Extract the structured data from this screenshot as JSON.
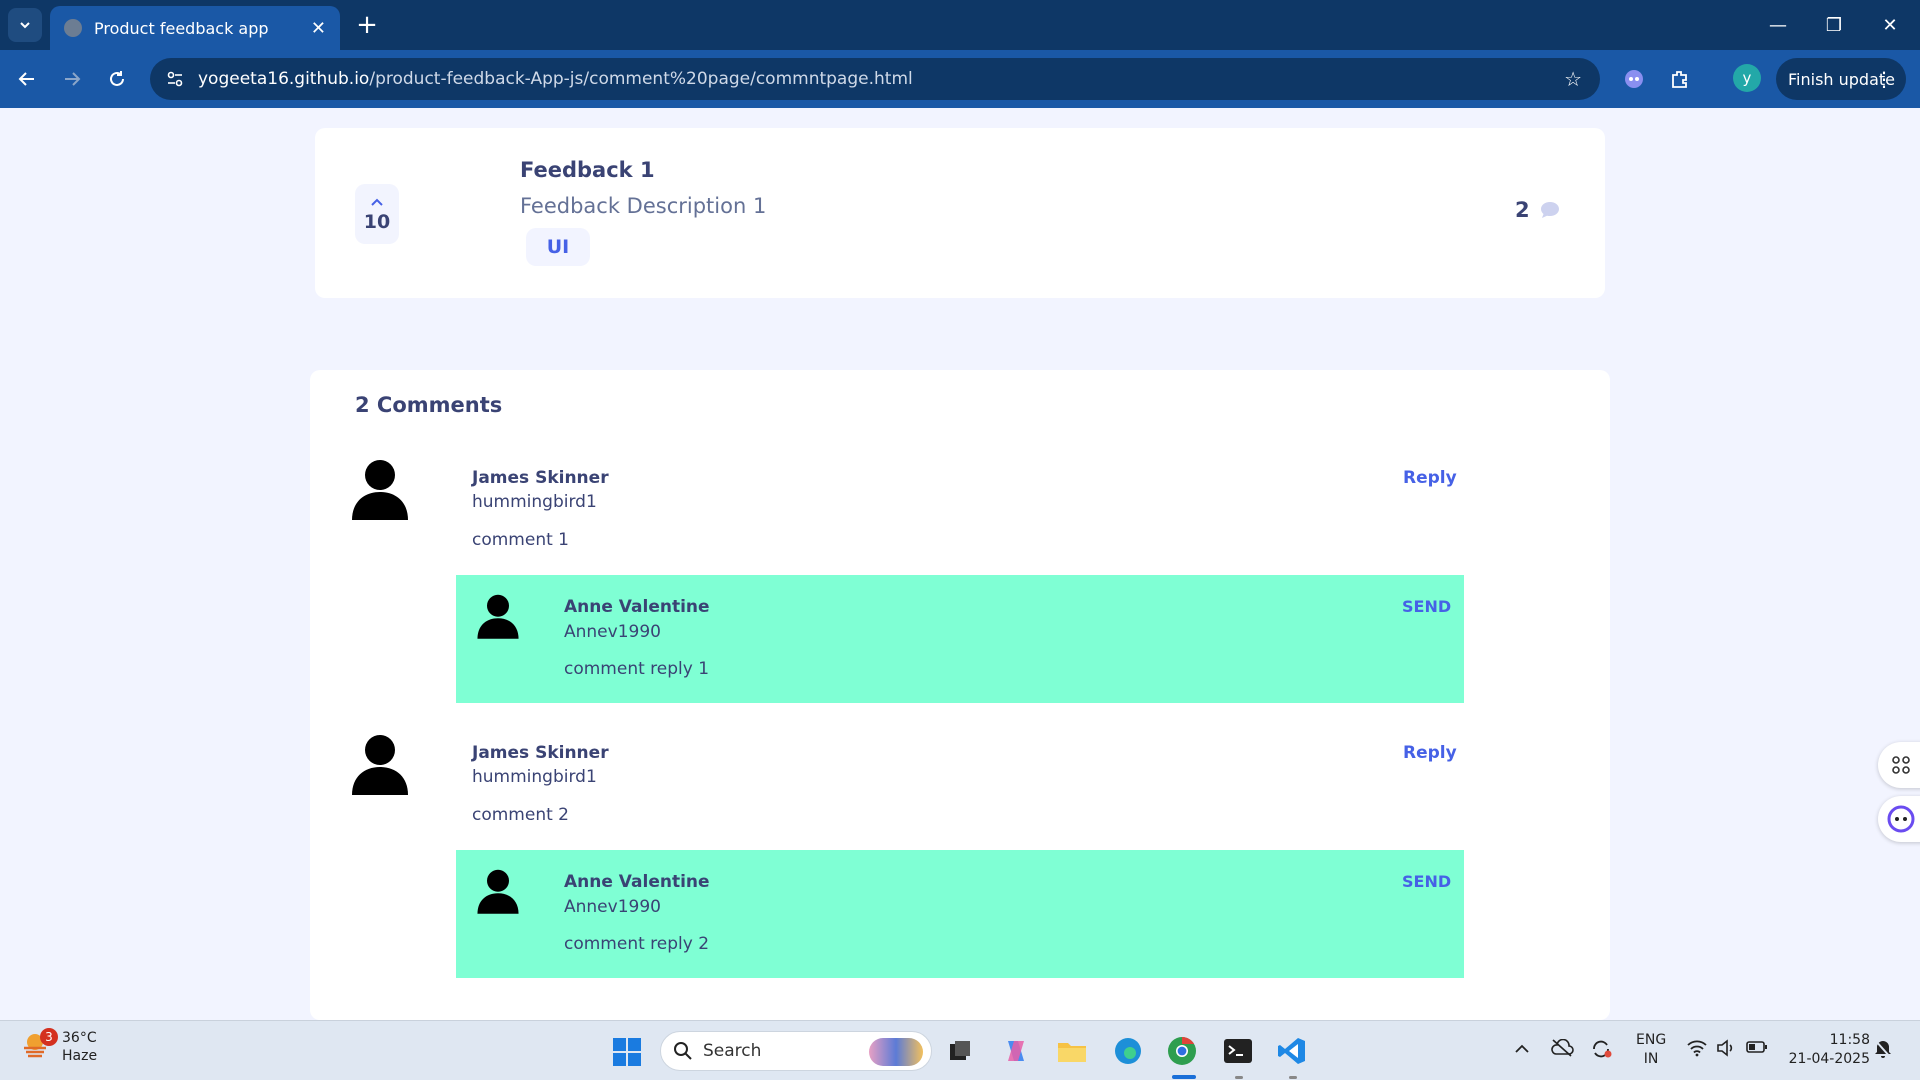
{
  "browser": {
    "tab_title": "Product feedback app",
    "url_host": "yogeeta16.github.io",
    "url_path": "/product-feedback-App-js/comment%20page/commntpage.html",
    "profile_initial": "y",
    "finish_update_label": "Finish update"
  },
  "feedback": {
    "upvotes": "10",
    "title": "Feedback 1",
    "description": "Feedback Description 1",
    "category": "UI",
    "comment_count": "2"
  },
  "comments_section": {
    "heading": "2 Comments",
    "comments": [
      {
        "name": "James Skinner",
        "username": "hummingbird1",
        "text": "comment 1",
        "reply_label": "Reply",
        "reply": {
          "name": "Anne Valentine",
          "username": "Annev1990",
          "text": "comment reply 1",
          "send_label": "SEND"
        }
      },
      {
        "name": "James Skinner",
        "username": "hummingbird1",
        "text": "comment 2",
        "reply_label": "Reply",
        "reply": {
          "name": "Anne Valentine",
          "username": "Annev1990",
          "text": "comment reply 2",
          "send_label": "SEND"
        }
      }
    ]
  },
  "taskbar": {
    "weather_badge": "3",
    "temperature": "36°C",
    "condition": "Haze",
    "search_label": "Search",
    "lang_line1": "ENG",
    "lang_line2": "IN",
    "time": "11:58",
    "date": "21-04-2025"
  },
  "colors": {
    "accent": "#4661e6",
    "text_dark": "#3a4374",
    "reply_bg": "#7fffd4",
    "page_bg": "#f2f4ff",
    "browser_toolbar": "#1a58a6"
  }
}
